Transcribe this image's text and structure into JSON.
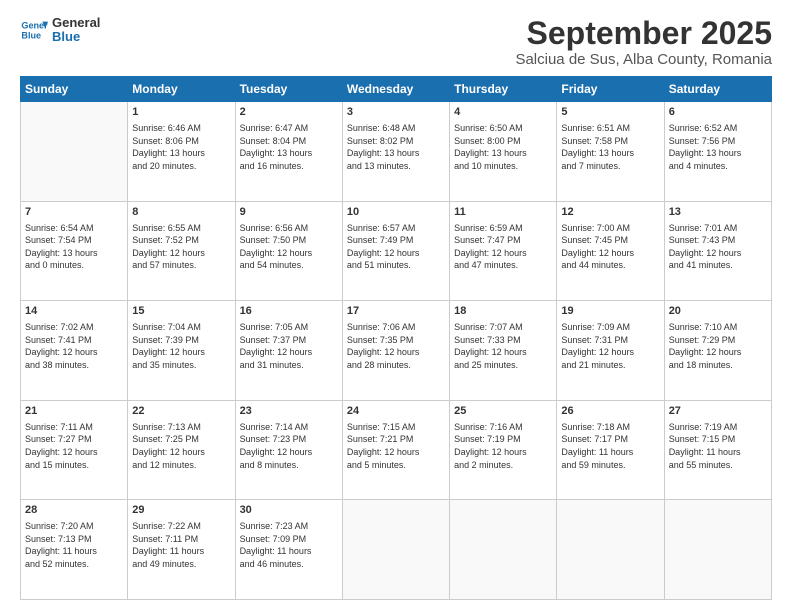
{
  "header": {
    "logo_line1": "General",
    "logo_line2": "Blue",
    "month": "September 2025",
    "location": "Salciua de Sus, Alba County, Romania"
  },
  "days_of_week": [
    "Sunday",
    "Monday",
    "Tuesday",
    "Wednesday",
    "Thursday",
    "Friday",
    "Saturday"
  ],
  "weeks": [
    [
      {
        "day": "",
        "info": ""
      },
      {
        "day": "1",
        "info": "Sunrise: 6:46 AM\nSunset: 8:06 PM\nDaylight: 13 hours\nand 20 minutes."
      },
      {
        "day": "2",
        "info": "Sunrise: 6:47 AM\nSunset: 8:04 PM\nDaylight: 13 hours\nand 16 minutes."
      },
      {
        "day": "3",
        "info": "Sunrise: 6:48 AM\nSunset: 8:02 PM\nDaylight: 13 hours\nand 13 minutes."
      },
      {
        "day": "4",
        "info": "Sunrise: 6:50 AM\nSunset: 8:00 PM\nDaylight: 13 hours\nand 10 minutes."
      },
      {
        "day": "5",
        "info": "Sunrise: 6:51 AM\nSunset: 7:58 PM\nDaylight: 13 hours\nand 7 minutes."
      },
      {
        "day": "6",
        "info": "Sunrise: 6:52 AM\nSunset: 7:56 PM\nDaylight: 13 hours\nand 4 minutes."
      }
    ],
    [
      {
        "day": "7",
        "info": "Sunrise: 6:54 AM\nSunset: 7:54 PM\nDaylight: 13 hours\nand 0 minutes."
      },
      {
        "day": "8",
        "info": "Sunrise: 6:55 AM\nSunset: 7:52 PM\nDaylight: 12 hours\nand 57 minutes."
      },
      {
        "day": "9",
        "info": "Sunrise: 6:56 AM\nSunset: 7:50 PM\nDaylight: 12 hours\nand 54 minutes."
      },
      {
        "day": "10",
        "info": "Sunrise: 6:57 AM\nSunset: 7:49 PM\nDaylight: 12 hours\nand 51 minutes."
      },
      {
        "day": "11",
        "info": "Sunrise: 6:59 AM\nSunset: 7:47 PM\nDaylight: 12 hours\nand 47 minutes."
      },
      {
        "day": "12",
        "info": "Sunrise: 7:00 AM\nSunset: 7:45 PM\nDaylight: 12 hours\nand 44 minutes."
      },
      {
        "day": "13",
        "info": "Sunrise: 7:01 AM\nSunset: 7:43 PM\nDaylight: 12 hours\nand 41 minutes."
      }
    ],
    [
      {
        "day": "14",
        "info": "Sunrise: 7:02 AM\nSunset: 7:41 PM\nDaylight: 12 hours\nand 38 minutes."
      },
      {
        "day": "15",
        "info": "Sunrise: 7:04 AM\nSunset: 7:39 PM\nDaylight: 12 hours\nand 35 minutes."
      },
      {
        "day": "16",
        "info": "Sunrise: 7:05 AM\nSunset: 7:37 PM\nDaylight: 12 hours\nand 31 minutes."
      },
      {
        "day": "17",
        "info": "Sunrise: 7:06 AM\nSunset: 7:35 PM\nDaylight: 12 hours\nand 28 minutes."
      },
      {
        "day": "18",
        "info": "Sunrise: 7:07 AM\nSunset: 7:33 PM\nDaylight: 12 hours\nand 25 minutes."
      },
      {
        "day": "19",
        "info": "Sunrise: 7:09 AM\nSunset: 7:31 PM\nDaylight: 12 hours\nand 21 minutes."
      },
      {
        "day": "20",
        "info": "Sunrise: 7:10 AM\nSunset: 7:29 PM\nDaylight: 12 hours\nand 18 minutes."
      }
    ],
    [
      {
        "day": "21",
        "info": "Sunrise: 7:11 AM\nSunset: 7:27 PM\nDaylight: 12 hours\nand 15 minutes."
      },
      {
        "day": "22",
        "info": "Sunrise: 7:13 AM\nSunset: 7:25 PM\nDaylight: 12 hours\nand 12 minutes."
      },
      {
        "day": "23",
        "info": "Sunrise: 7:14 AM\nSunset: 7:23 PM\nDaylight: 12 hours\nand 8 minutes."
      },
      {
        "day": "24",
        "info": "Sunrise: 7:15 AM\nSunset: 7:21 PM\nDaylight: 12 hours\nand 5 minutes."
      },
      {
        "day": "25",
        "info": "Sunrise: 7:16 AM\nSunset: 7:19 PM\nDaylight: 12 hours\nand 2 minutes."
      },
      {
        "day": "26",
        "info": "Sunrise: 7:18 AM\nSunset: 7:17 PM\nDaylight: 11 hours\nand 59 minutes."
      },
      {
        "day": "27",
        "info": "Sunrise: 7:19 AM\nSunset: 7:15 PM\nDaylight: 11 hours\nand 55 minutes."
      }
    ],
    [
      {
        "day": "28",
        "info": "Sunrise: 7:20 AM\nSunset: 7:13 PM\nDaylight: 11 hours\nand 52 minutes."
      },
      {
        "day": "29",
        "info": "Sunrise: 7:22 AM\nSunset: 7:11 PM\nDaylight: 11 hours\nand 49 minutes."
      },
      {
        "day": "30",
        "info": "Sunrise: 7:23 AM\nSunset: 7:09 PM\nDaylight: 11 hours\nand 46 minutes."
      },
      {
        "day": "",
        "info": ""
      },
      {
        "day": "",
        "info": ""
      },
      {
        "day": "",
        "info": ""
      },
      {
        "day": "",
        "info": ""
      }
    ]
  ]
}
